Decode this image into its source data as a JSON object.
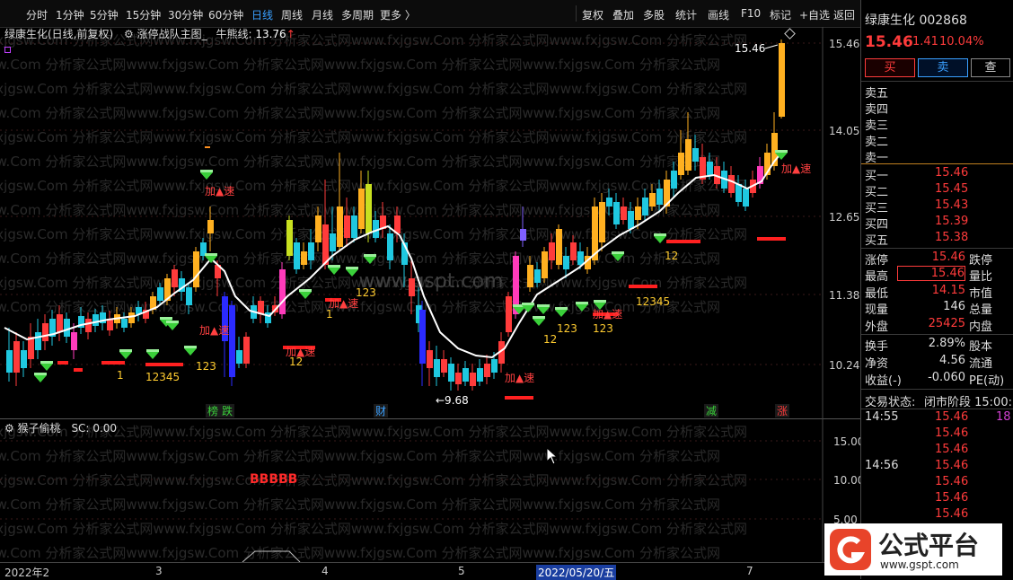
{
  "toolbar": {
    "periods": [
      "分时",
      "1分钟",
      "5分钟",
      "15分钟",
      "30分钟",
      "60分钟",
      "日线",
      "周线",
      "月线",
      "多周期",
      "更多 〉"
    ],
    "active_period": "日线",
    "actions": [
      "复权",
      "叠加",
      "多股",
      "统计",
      "画线",
      "F10",
      "标记",
      "+自选",
      "返回"
    ]
  },
  "chart_header": {
    "stock_label": "绿康生化(日线,前复权)",
    "indicator_name": "涨停战队主图_",
    "bull_line_label": "牛熊线:",
    "bull_line_value": "13.76",
    "bull_arrow": "↑"
  },
  "price_axis": [
    "15.46",
    "14.05",
    "12.65",
    "11.38",
    "10.24"
  ],
  "sub_header": {
    "name": "猴子偷桃",
    "sc_label": "SC:",
    "sc_value": "0.00"
  },
  "sub_axis": [
    "15.00",
    "10.00",
    "5.00"
  ],
  "sub_signal_text": "BBBBB",
  "time_axis": [
    "2022年2",
    "3",
    "4",
    "5",
    "2022/05/20/五",
    "7"
  ],
  "event_tags": [
    "榜",
    "跌",
    "财",
    "减",
    "涨"
  ],
  "annotations": {
    "high_label": "15.46",
    "low_label": "9.68",
    "speed_label": "加▲速",
    "counts": [
      "1",
      "12345",
      "123",
      "12",
      "1",
      "123",
      "12",
      "123",
      "123",
      "12345",
      "12"
    ]
  },
  "watermark_text": "fxjgsw.Com 分析家公式网www.fxjgsw.Com 分析家公式网www.fxjgsw.Com 分析家公式网www.fxjgsw.Com 分析家公式网",
  "center_watermark": "www.gspt.com",
  "quote": {
    "title": "绿康生化 002868",
    "price": "15.46",
    "change": "1.41",
    "change_pct": "10.04%",
    "buy_button": "买",
    "sell_button": "卖",
    "query_button": "查",
    "asks": [
      {
        "label": "卖五",
        "value": ""
      },
      {
        "label": "卖四",
        "value": ""
      },
      {
        "label": "卖三",
        "value": ""
      },
      {
        "label": "卖二",
        "value": ""
      },
      {
        "label": "卖一",
        "value": ""
      }
    ],
    "bids": [
      {
        "label": "买一",
        "value": "15.46"
      },
      {
        "label": "买二",
        "value": "15.45"
      },
      {
        "label": "买三",
        "value": "15.43"
      },
      {
        "label": "买四",
        "value": "15.39"
      },
      {
        "label": "买五",
        "value": "15.38"
      }
    ],
    "stats": [
      {
        "label": "涨停",
        "value": "15.46",
        "right": "跌停",
        "color": "#ff3b3b"
      },
      {
        "label": "最高",
        "value": "15.46",
        "right": "量比",
        "color": "#ff3b3b"
      },
      {
        "label": "最低",
        "value": "14.15",
        "right": "市值",
        "color": "#ff3b3b"
      },
      {
        "label": "现量",
        "value": "146",
        "right": "总量",
        "color": "#dddddd"
      },
      {
        "label": "外盘",
        "value": "25425",
        "right": "内盘",
        "color": "#ff3b3b"
      },
      {
        "label": "换手",
        "value": "2.89%",
        "right": "股本",
        "color": "#dddddd"
      },
      {
        "label": "净资",
        "value": "4.56",
        "right": "流通",
        "color": "#dddddd"
      },
      {
        "label": "收益(-)",
        "value": "-0.060",
        "right": "PE(动)",
        "color": "#dddddd"
      }
    ],
    "trade_status_label": "交易状态:",
    "trade_status_value": "闭市阶段 15:00:",
    "ticks": [
      {
        "time": "14:55",
        "price": "15.46",
        "extra": "18"
      },
      {
        "time": "",
        "price": "15.46",
        "extra": ""
      },
      {
        "time": "",
        "price": "15.46",
        "extra": ""
      },
      {
        "time": "14:56",
        "price": "15.46",
        "extra": ""
      },
      {
        "time": "",
        "price": "15.46",
        "extra": ""
      },
      {
        "time": "",
        "price": "15.46",
        "extra": ""
      },
      {
        "time": "",
        "price": "15.46",
        "extra": ""
      }
    ]
  },
  "logo": {
    "text": "公式平台",
    "url_text": "www.gspt.com"
  }
}
